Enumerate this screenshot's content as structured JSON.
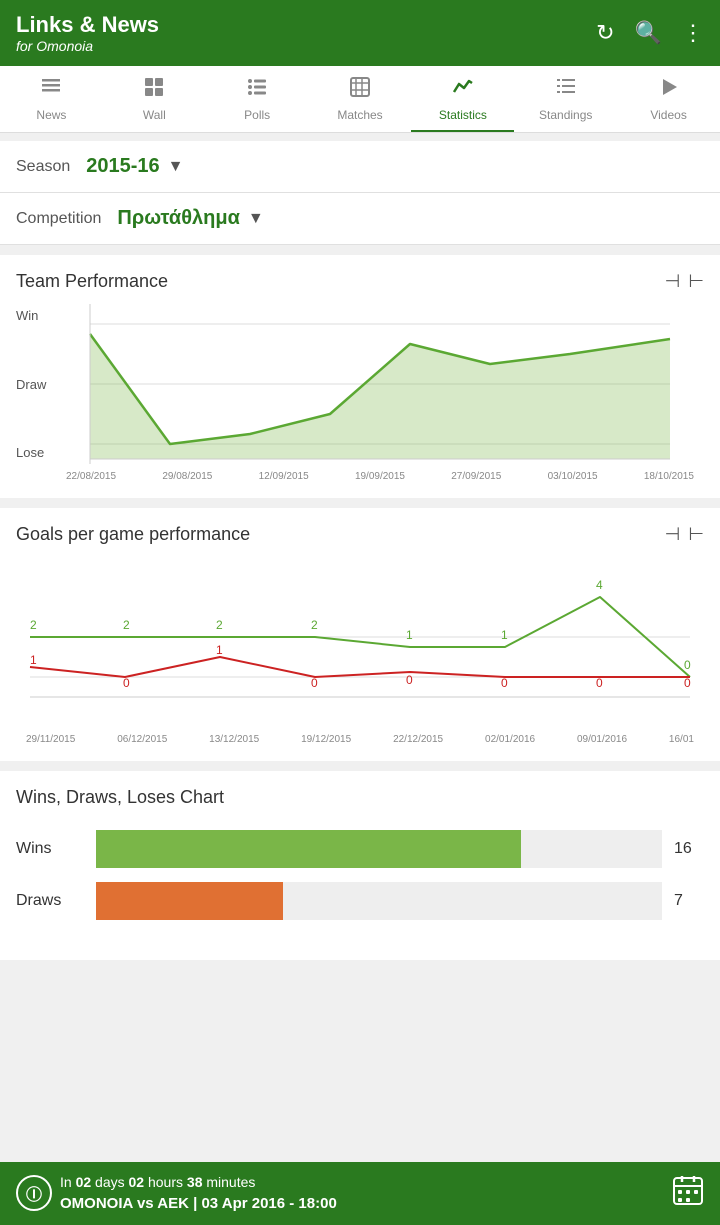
{
  "header": {
    "app_name": "Links & News",
    "app_sub": "for Omonoia",
    "icons": [
      "refresh",
      "search",
      "more"
    ]
  },
  "nav": {
    "tabs": [
      {
        "id": "news",
        "label": "News",
        "icon": "☰"
      },
      {
        "id": "wall",
        "label": "Wall",
        "icon": "✏"
      },
      {
        "id": "polls",
        "label": "Polls",
        "icon": "≡"
      },
      {
        "id": "matches",
        "label": "Matches",
        "icon": "▦"
      },
      {
        "id": "statistics",
        "label": "Statistics",
        "icon": "📈",
        "active": true
      },
      {
        "id": "standings",
        "label": "Standings",
        "icon": "≡"
      },
      {
        "id": "videos",
        "label": "Videos",
        "icon": "▷"
      }
    ]
  },
  "season": {
    "label": "Season",
    "value": "2015-16"
  },
  "competition": {
    "label": "Competition",
    "value": "Πρωτάθλημα"
  },
  "team_performance": {
    "title": "Team Performance",
    "y_labels": [
      "Win",
      "Draw",
      "Lose"
    ],
    "x_labels": [
      "22/08/2015",
      "29/08/2015",
      "12/09/2015",
      "19/09/2015",
      "27/09/2015",
      "03/10/2015",
      "18/10/2015"
    ]
  },
  "goals_chart": {
    "title": "Goals per game performance",
    "x_labels": [
      "29/11/2015",
      "06/12/2015",
      "13/12/2015",
      "19/12/2015",
      "22/12/2015",
      "02/01/2016",
      "09/01/2016",
      "16/01"
    ],
    "green_values": [
      2,
      2,
      2,
      2,
      1,
      1,
      4,
      0
    ],
    "red_values": [
      1,
      0,
      1,
      0,
      0,
      0,
      0,
      0
    ]
  },
  "wdl_chart": {
    "title": "Wins, Draws, Loses Chart",
    "bars": [
      {
        "label": "Wins",
        "value": 16,
        "color": "#7ab648",
        "pct": 75
      },
      {
        "label": "Draws",
        "value": 7,
        "color": "#e07033",
        "pct": 33
      }
    ]
  },
  "bottom_bar": {
    "timer": "In",
    "days": "02",
    "days_label": "days",
    "hours": "02",
    "hours_label": "hours",
    "minutes": "38",
    "minutes_label": "minutes",
    "match": "OMONOIA vs AEK | 03 Apr 2016 - 18:00"
  }
}
